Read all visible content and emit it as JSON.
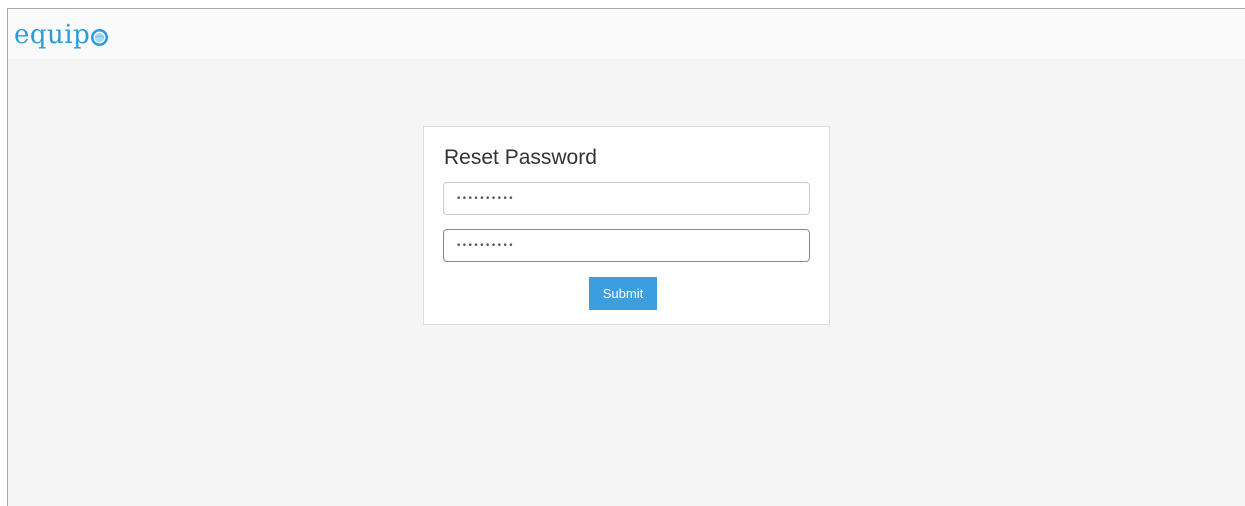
{
  "brand": {
    "name": "equipo",
    "text": "equip",
    "mark_icon": "globe-o-icon",
    "color": "#2f9bd6"
  },
  "reset_form": {
    "title": "Reset Password",
    "new_password_value": "••••••••••",
    "confirm_password_value": "••••••••••",
    "submit_label": "Submit",
    "submit_color": "#3b9ee0"
  }
}
